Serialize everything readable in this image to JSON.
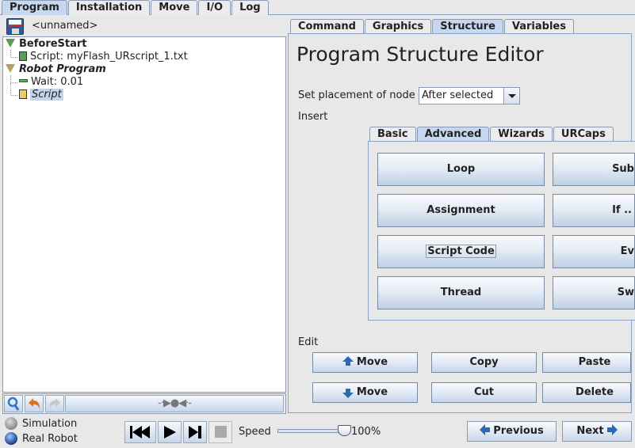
{
  "top_tabs": [
    {
      "label": "Program",
      "active": true
    },
    {
      "label": "Installation",
      "active": false
    },
    {
      "label": "Move",
      "active": false
    },
    {
      "label": "I/O",
      "active": false
    },
    {
      "label": "Log",
      "active": false
    }
  ],
  "left": {
    "program_name": "<unnamed>",
    "tree": {
      "before_start": "BeforeStart",
      "before_start_script": "Script: myFlash_URscript_1.txt",
      "robot_program": "Robot Program",
      "wait": "Wait: 0.01",
      "script": "Script"
    },
    "bottom_toolbar": {
      "search": "search-icon",
      "undo": "undo-icon",
      "redo": "redo-icon",
      "collapse_glyph": "-·▶●◀·-"
    }
  },
  "right": {
    "tabs": [
      {
        "label": "Command",
        "active": false
      },
      {
        "label": "Graphics",
        "active": false
      },
      {
        "label": "Structure",
        "active": true
      },
      {
        "label": "Variables",
        "active": false
      }
    ],
    "title": "Program Structure Editor",
    "placement_label": "Set placement of node",
    "placement_value": "After selected",
    "insert_label": "Insert",
    "insert_tabs": [
      {
        "label": "Basic",
        "active": false
      },
      {
        "label": "Advanced",
        "active": true
      },
      {
        "label": "Wizards",
        "active": false
      },
      {
        "label": "URCaps",
        "active": false
      }
    ],
    "insert_buttons_left": [
      "Loop",
      "Assignment",
      "Script Code",
      "Thread"
    ],
    "insert_buttons_right_visible": [
      "Sub",
      "If ..",
      "Ev",
      "Sw"
    ],
    "edit_label": "Edit",
    "edit_buttons": {
      "move_up": "Move",
      "move_down": "Move",
      "copy": "Copy",
      "cut": "Cut",
      "paste": "Paste",
      "delete": "Delete"
    }
  },
  "footer": {
    "simulation": "Simulation",
    "real_robot": "Real Robot",
    "mode_selected": "Real Robot",
    "speed_label": "Speed",
    "speed_percent": 100,
    "speed_text": "100%",
    "previous": "Previous",
    "next": "Next"
  }
}
